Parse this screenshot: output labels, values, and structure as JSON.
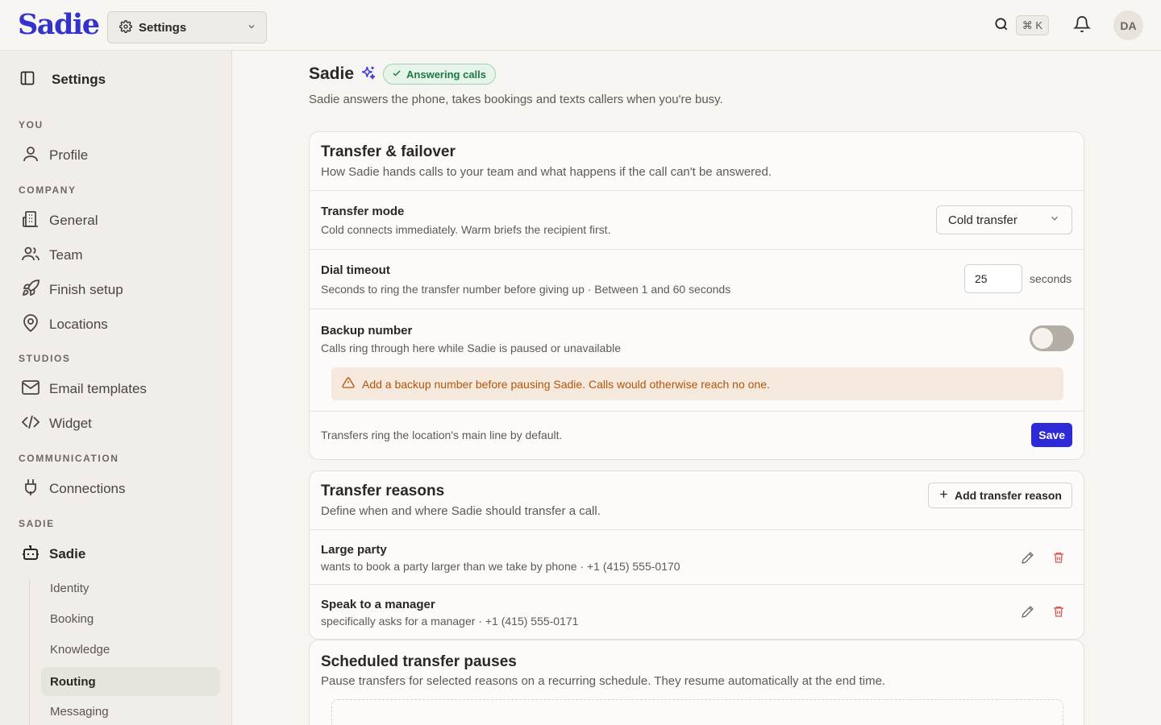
{
  "topbar": {
    "logo": "Sadie",
    "workspace_select": "Settings",
    "shortcut": "⌘ K",
    "avatar_initials": "DA"
  },
  "sidebar": {
    "title": "Settings",
    "sections": {
      "you": "YOU",
      "company": "COMPANY",
      "studios": "STUDIOS",
      "communication": "COMMUNICATION",
      "sadie": "SADIE"
    },
    "items": {
      "profile": "Profile",
      "general": "General",
      "team": "Team",
      "finish_setup": "Finish setup",
      "locations": "Locations",
      "email_templates": "Email templates",
      "widget": "Widget",
      "connections": "Connections",
      "sadie": "Sadie"
    },
    "sub_items": [
      "Identity",
      "Booking",
      "Knowledge",
      "Routing",
      "Messaging"
    ],
    "active_sub_item": "Routing"
  },
  "page": {
    "title": "Sadie",
    "status_badge": "Answering calls",
    "subtitle": "Sadie answers the phone, takes bookings and texts callers when you're busy."
  },
  "transfer_card": {
    "title": "Transfer & failover",
    "description": "How Sadie hands calls to your team and what happens if the call can't be answered.",
    "mode": {
      "label": "Transfer mode",
      "description": "Cold connects immediately. Warm briefs the recipient first.",
      "value": "Cold transfer"
    },
    "timeout": {
      "label": "Dial timeout",
      "description": "Seconds to ring the transfer number before giving up · Between 1 and 60 seconds",
      "value": "25",
      "unit": "seconds"
    },
    "backup": {
      "label": "Backup number",
      "description": "Calls ring through here while Sadie is paused or unavailable",
      "enabled": false,
      "warning": "Add a backup number before pausing Sadie. Calls would otherwise reach no one."
    },
    "footer_note": "Transfers ring the location's main line by default.",
    "save_label": "Save"
  },
  "reasons_card": {
    "title": "Transfer reasons",
    "description": "Define when and where Sadie should transfer a call.",
    "add_label": "Add transfer reason",
    "items": [
      {
        "title": "Large party",
        "detail": "wants to book a party larger than we take by phone · +1 (415) 555-0170"
      },
      {
        "title": "Speak to a manager",
        "detail": "specifically asks for a manager · +1 (415) 555-0171"
      }
    ]
  },
  "pauses_card": {
    "title": "Scheduled transfer pauses",
    "description": "Pause transfers for selected reasons on a recurring schedule. They resume automatically at the end time."
  },
  "colors": {
    "accent": "#2f2ad8",
    "logo": "#3333cc",
    "success": "#1d7a44",
    "warning": "#b2560b",
    "danger": "#d9534f"
  }
}
